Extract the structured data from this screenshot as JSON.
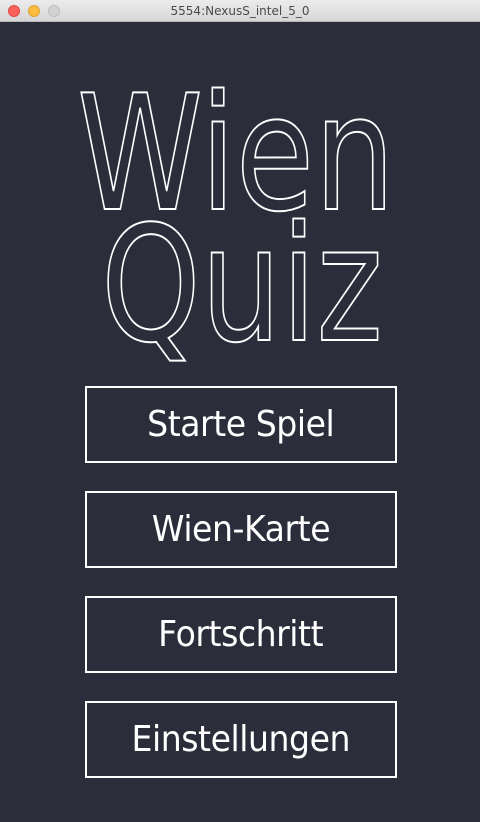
{
  "window": {
    "title": "5554:NexusS_intel_5_0"
  },
  "logo": {
    "line1": "Wien",
    "line2": "Quiz"
  },
  "menu": {
    "start_label": "Starte Spiel",
    "map_label": "Wien-Karte",
    "progress_label": "Fortschritt",
    "settings_label": "Einstellungen"
  },
  "colors": {
    "background": "#2b2d3b",
    "foreground": "#ffffff"
  }
}
